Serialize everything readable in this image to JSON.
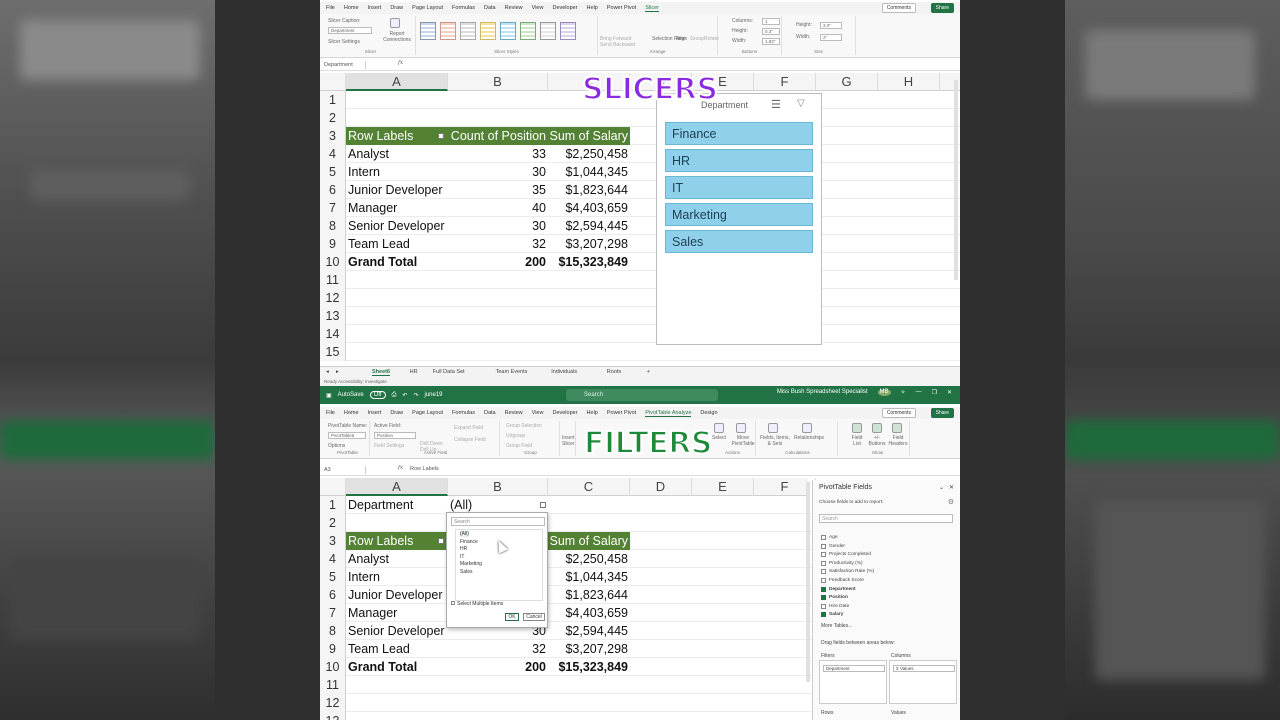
{
  "overlay": {
    "top_title": "SLICERS",
    "bottom_title": "FILTERS"
  },
  "top": {
    "menu_tabs": [
      "File",
      "Home",
      "Insert",
      "Draw",
      "Page Layout",
      "Formulas",
      "Data",
      "Review",
      "View",
      "Developer",
      "Help",
      "Power Pivot",
      "Slicer"
    ],
    "active_tab": "Slicer",
    "comments_label": "Comments",
    "share_label": "Share",
    "ribbon": {
      "slicer_caption_label": "Slicer Caption:",
      "slicer_caption_value": "Department",
      "slicer_settings": "Slicer Settings",
      "report_connections": "Report Connections",
      "group_slicer": "Slicer",
      "group_styles": "Slicer Styles",
      "group_arrange": "Arrange",
      "group_buttons": "Buttons",
      "group_size": "Size",
      "bring_forward": "Bring Forward",
      "send_backward": "Send Backward",
      "selection_pane": "Selection Pane",
      "align": "Align",
      "group": "Group",
      "rotate": "Rotate",
      "columns_label": "Columns:",
      "columns_value": "1",
      "height_label": "Height:",
      "height_value": "0.3\"",
      "width_label": "Width:",
      "width_value": "1.83\"",
      "size_height_label": "Height:",
      "size_height_value": "3.0\"",
      "size_width_label": "Width:",
      "size_width_value": "2\""
    },
    "name_box": "Department",
    "fx": "fx",
    "columns": [
      "A",
      "B",
      "C",
      "D",
      "E",
      "F",
      "G",
      "H"
    ],
    "rows": [
      {
        "n": "1",
        "a": "",
        "b": "",
        "c": ""
      },
      {
        "n": "2",
        "a": "",
        "b": "",
        "c": ""
      },
      {
        "n": "3",
        "a": "Row Labels",
        "b": "Count of Position",
        "c": "Sum of Salary",
        "hdr": true
      },
      {
        "n": "4",
        "a": "Analyst",
        "b": "33",
        "c": "$2,250,458"
      },
      {
        "n": "5",
        "a": "Intern",
        "b": "30",
        "c": "$1,044,345"
      },
      {
        "n": "6",
        "a": "Junior Developer",
        "b": "35",
        "c": "$1,823,644"
      },
      {
        "n": "7",
        "a": "Manager",
        "b": "40",
        "c": "$4,403,659"
      },
      {
        "n": "8",
        "a": "Senior Developer",
        "b": "30",
        "c": "$2,594,445"
      },
      {
        "n": "9",
        "a": "Team Lead",
        "b": "32",
        "c": "$3,207,298"
      },
      {
        "n": "10",
        "a": "Grand Total",
        "b": "200",
        "c": "$15,323,849",
        "total": true
      },
      {
        "n": "11",
        "a": "",
        "b": "",
        "c": ""
      },
      {
        "n": "12",
        "a": "",
        "b": "",
        "c": ""
      },
      {
        "n": "13",
        "a": "",
        "b": "",
        "c": ""
      },
      {
        "n": "14",
        "a": "",
        "b": "",
        "c": ""
      },
      {
        "n": "15",
        "a": "",
        "b": "",
        "c": ""
      }
    ],
    "slicer": {
      "title": "Department",
      "items": [
        "Finance",
        "HR",
        "IT",
        "Marketing",
        "Sales"
      ]
    },
    "sheet_tabs": [
      "Sheet6",
      "HR",
      "Full Data Set",
      "Team Events",
      "Individuals",
      "Roots"
    ],
    "active_sheet": "Sheet6",
    "status": "Ready   Accessibility: Investigate"
  },
  "bottom": {
    "title_bar": {
      "autosave": "AutoSave",
      "autosave_state": "Off",
      "filename": "june19",
      "search_placeholder": "Search",
      "user": "Miss Bush Spreadsheet Specialist",
      "initials": "MB"
    },
    "menu_tabs": [
      "File",
      "Home",
      "Insert",
      "Draw",
      "Page Layout",
      "Formulas",
      "Data",
      "Review",
      "View",
      "Developer",
      "Help",
      "Power Pivot",
      "PivotTable Analyze",
      "Design"
    ],
    "active_tab": "PivotTable Analyze",
    "comments_label": "Comments",
    "share_label": "Share",
    "ribbon": {
      "pivot_name_label": "PivotTable Name:",
      "pivot_name_value": "PivotTable6",
      "options": "Options",
      "group_pivottable": "PivotTable",
      "active_field_label": "Active Field:",
      "active_field_value": "Position",
      "field_settings": "Field Settings",
      "drill_down": "Drill Down",
      "drill_up": "Drill Up",
      "expand_field": "Expand Field",
      "collapse_field": "Collapse Field",
      "group_active_field": "Active Field",
      "group_selection": "Group Selection",
      "ungroup": "Ungroup",
      "group_field": "Group Field",
      "group_group": "Group",
      "insert_slicer": "Insert Slicer",
      "select": "Select",
      "move_pivottable": "Move PivotTable",
      "group_actions": "Actions",
      "fields_items_sets": "Fields, Items, & Sets",
      "relationships": "Relationships",
      "group_calculations": "Calculations",
      "field_list": "Field List",
      "buttons": "+/- Buttons",
      "field_headers": "Field Headers",
      "group_show": "Show"
    },
    "name_box": "A3",
    "fx": "fx",
    "formula": "Row Labels",
    "columns": [
      "A",
      "B",
      "C",
      "D",
      "E",
      "F"
    ],
    "rows": [
      {
        "n": "1",
        "a": "Department",
        "b": "(All)",
        "c": "",
        "filter": true
      },
      {
        "n": "2",
        "a": "",
        "b": "",
        "c": ""
      },
      {
        "n": "3",
        "a": "Row Labels",
        "b": "",
        "c": "Sum of Salary",
        "hdr": true
      },
      {
        "n": "4",
        "a": "Analyst",
        "b": "",
        "c": "$2,250,458"
      },
      {
        "n": "5",
        "a": "Intern",
        "b": "",
        "c": "$1,044,345"
      },
      {
        "n": "6",
        "a": "Junior Developer",
        "b": "",
        "c": "$1,823,644"
      },
      {
        "n": "7",
        "a": "Manager",
        "b": "",
        "c": "$4,403,659"
      },
      {
        "n": "8",
        "a": "Senior Developer",
        "b": "30",
        "c": "$2,594,445"
      },
      {
        "n": "9",
        "a": "Team Lead",
        "b": "32",
        "c": "$3,207,298"
      },
      {
        "n": "10",
        "a": "Grand Total",
        "b": "200",
        "c": "$15,323,849",
        "total": true
      },
      {
        "n": "11",
        "a": "",
        "b": "",
        "c": ""
      },
      {
        "n": "12",
        "a": "",
        "b": "",
        "c": ""
      },
      {
        "n": "13",
        "a": "",
        "b": "",
        "c": ""
      }
    ],
    "filter_dropdown": {
      "search_placeholder": "Search",
      "items": [
        "(All)",
        "Finance",
        "HR",
        "IT",
        "Marketing",
        "Sales"
      ],
      "select_multiple": "Select Multiple Items",
      "ok": "OK",
      "cancel": "Cancel"
    },
    "pivot_fields": {
      "title": "PivotTable Fields",
      "subtitle": "Choose fields to add to report:",
      "search_placeholder": "Search",
      "fields": [
        {
          "name": "Age",
          "checked": false
        },
        {
          "name": "Gender",
          "checked": false
        },
        {
          "name": "Projects Completed",
          "checked": false
        },
        {
          "name": "Productivity (%)",
          "checked": false
        },
        {
          "name": "Satisfaction Rate (%)",
          "checked": false
        },
        {
          "name": "Feedback Score",
          "checked": false
        },
        {
          "name": "Department",
          "checked": true
        },
        {
          "name": "Position",
          "checked": true
        },
        {
          "name": "Hire Date",
          "checked": false
        },
        {
          "name": "Salary",
          "checked": true
        }
      ],
      "more_tables": "More Tables...",
      "drag_label": "Drag fields between areas below:",
      "filters_label": "Filters",
      "columns_label": "Columns",
      "filters_value": "Department",
      "columns_value": "Σ Values",
      "rows_label": "Rows",
      "values_label": "Values"
    }
  },
  "colors": {
    "excel_green": "#217346",
    "pivot_header": "#548235",
    "slicer_item": "#8fd0ea",
    "slicers_title": "#8a2be2",
    "filters_title": "#1d8a3a"
  }
}
